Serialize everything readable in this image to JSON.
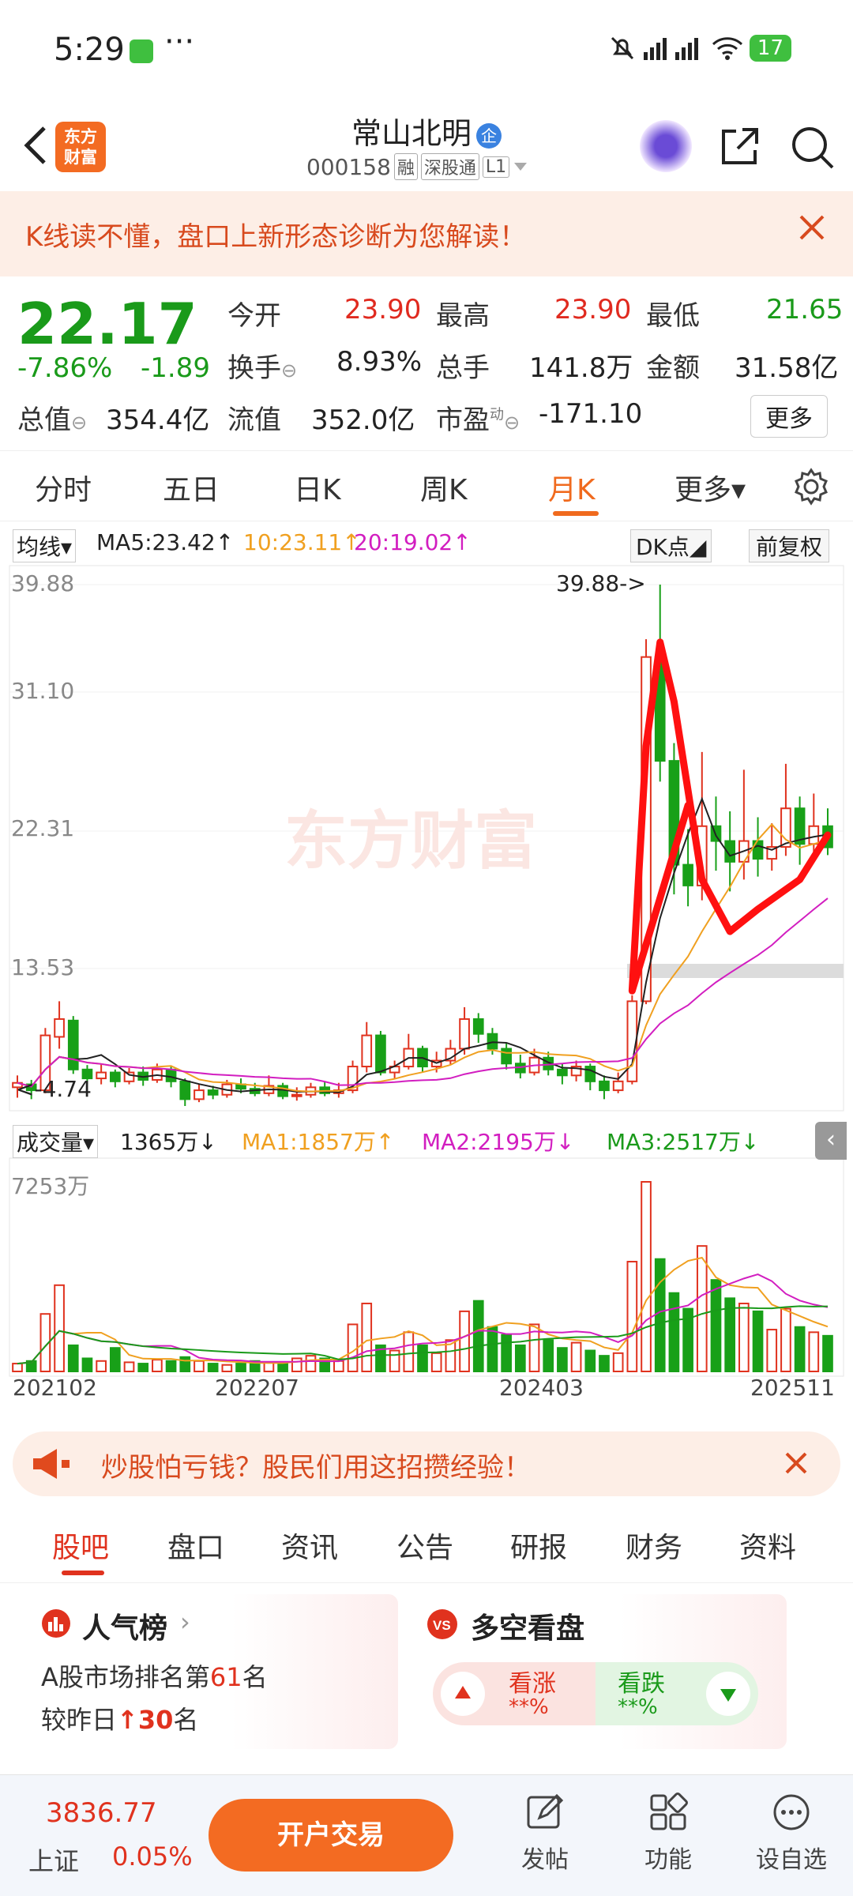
{
  "status": {
    "time": "5:29",
    "dots": "···",
    "battery": "17"
  },
  "header": {
    "title": "常山北明",
    "qi_badge": "企",
    "code": "000158",
    "tags": [
      "融",
      "深股通",
      "L1"
    ],
    "logo": "东方\n财富"
  },
  "banner": {
    "text": "K线读不懂，盘口上新形态诊断为您解读！"
  },
  "quote": {
    "price": "22.17",
    "change_pct": "-7.86%",
    "change": "-1.89",
    "open_label": "今开",
    "open": "23.90",
    "high_label": "最高",
    "high": "23.90",
    "low_label": "最低",
    "low": "21.65",
    "turnover_label": "换手",
    "turnover": "8.93%",
    "volume_label": "总手",
    "volume": "141.8万",
    "amount_label": "金额",
    "amount": "31.58亿",
    "mktcap_label": "总值",
    "mktcap": "354.4亿",
    "float_label": "流值",
    "float": "352.0亿",
    "pe_label": "市盈",
    "pe_sup": "动",
    "pe": "-171.10",
    "more": "更多"
  },
  "tabs": [
    "分时",
    "五日",
    "日K",
    "周K",
    "月K",
    "更多▾"
  ],
  "active_tab": "月K",
  "chart": {
    "ma_selector": "均线▾",
    "ma5": "MA5:23.42↑",
    "ma10": "10:23.11↑",
    "ma20": "20:19.02↑",
    "dk": "DK点◢",
    "adj": "前复权",
    "y_ticks": [
      "39.88",
      "31.10",
      "22.31",
      "13.53"
    ],
    "max_label": "39.88->",
    "min_label": "<-4.74",
    "watermark": "东方财富",
    "vol_selector": "成交量▾",
    "vol": "1365万↓",
    "vma1": "MA1:1857万↑",
    "vma2": "MA2:2195万↓",
    "vma3": "MA3:2517万↓",
    "vol_max": "7253万",
    "x_labels": [
      "202102",
      "202207",
      "202403",
      "202511"
    ]
  },
  "chart_data": {
    "type": "candlestick",
    "y_range": [
      4.74,
      39.88
    ],
    "candles": [
      {
        "o": 6.0,
        "c": 6.3,
        "h": 6.8,
        "l": 5.3
      },
      {
        "o": 6.2,
        "c": 5.8,
        "h": 6.5,
        "l": 5.2
      },
      {
        "o": 5.8,
        "c": 9.5,
        "h": 10.0,
        "l": 5.6
      },
      {
        "o": 9.4,
        "c": 10.6,
        "h": 11.8,
        "l": 8.6
      },
      {
        "o": 10.5,
        "c": 7.2,
        "h": 10.8,
        "l": 6.9
      },
      {
        "o": 7.2,
        "c": 6.6,
        "h": 7.5,
        "l": 6.2
      },
      {
        "o": 6.6,
        "c": 7.0,
        "h": 7.6,
        "l": 6.2
      },
      {
        "o": 7.0,
        "c": 6.4,
        "h": 7.2,
        "l": 6.0
      },
      {
        "o": 6.4,
        "c": 7.0,
        "h": 7.3,
        "l": 6.2
      },
      {
        "o": 7.0,
        "c": 6.5,
        "h": 7.4,
        "l": 6.1
      },
      {
        "o": 6.5,
        "c": 7.2,
        "h": 7.6,
        "l": 6.3
      },
      {
        "o": 7.2,
        "c": 6.4,
        "h": 7.4,
        "l": 6.0
      },
      {
        "o": 6.4,
        "c": 5.2,
        "h": 6.6,
        "l": 4.74
      },
      {
        "o": 5.2,
        "c": 5.8,
        "h": 6.2,
        "l": 5.0
      },
      {
        "o": 5.8,
        "c": 5.5,
        "h": 6.1,
        "l": 5.2
      },
      {
        "o": 5.5,
        "c": 6.2,
        "h": 6.5,
        "l": 5.3
      },
      {
        "o": 6.2,
        "c": 5.9,
        "h": 6.6,
        "l": 5.6
      },
      {
        "o": 5.9,
        "c": 5.6,
        "h": 6.3,
        "l": 5.4
      },
      {
        "o": 5.6,
        "c": 6.1,
        "h": 6.8,
        "l": 5.4
      },
      {
        "o": 6.1,
        "c": 5.4,
        "h": 6.3,
        "l": 5.2
      },
      {
        "o": 5.4,
        "c": 5.5,
        "h": 6.0,
        "l": 5.1
      },
      {
        "o": 5.5,
        "c": 6.0,
        "h": 6.3,
        "l": 5.3
      },
      {
        "o": 6.0,
        "c": 5.6,
        "h": 6.4,
        "l": 5.4
      },
      {
        "o": 5.6,
        "c": 5.8,
        "h": 6.3,
        "l": 5.3
      },
      {
        "o": 5.8,
        "c": 7.4,
        "h": 7.8,
        "l": 5.6
      },
      {
        "o": 7.4,
        "c": 9.5,
        "h": 10.4,
        "l": 7.0
      },
      {
        "o": 9.5,
        "c": 7.0,
        "h": 9.8,
        "l": 6.8
      },
      {
        "o": 7.0,
        "c": 7.4,
        "h": 7.8,
        "l": 6.6
      },
      {
        "o": 7.4,
        "c": 8.6,
        "h": 9.6,
        "l": 7.2
      },
      {
        "o": 8.6,
        "c": 7.4,
        "h": 8.8,
        "l": 7.0
      },
      {
        "o": 7.4,
        "c": 7.8,
        "h": 8.4,
        "l": 7.0
      },
      {
        "o": 7.8,
        "c": 8.6,
        "h": 9.2,
        "l": 7.5
      },
      {
        "o": 8.6,
        "c": 10.6,
        "h": 11.4,
        "l": 8.2
      },
      {
        "o": 10.6,
        "c": 9.6,
        "h": 11.0,
        "l": 9.0
      },
      {
        "o": 9.6,
        "c": 8.6,
        "h": 10.0,
        "l": 8.2
      },
      {
        "o": 8.6,
        "c": 7.6,
        "h": 9.0,
        "l": 7.2
      },
      {
        "o": 7.6,
        "c": 7.0,
        "h": 8.2,
        "l": 6.6
      },
      {
        "o": 7.0,
        "c": 8.0,
        "h": 8.6,
        "l": 6.8
      },
      {
        "o": 8.0,
        "c": 7.2,
        "h": 8.4,
        "l": 6.8
      },
      {
        "o": 7.2,
        "c": 6.8,
        "h": 7.6,
        "l": 6.2
      },
      {
        "o": 6.8,
        "c": 7.4,
        "h": 7.8,
        "l": 6.4
      },
      {
        "o": 7.4,
        "c": 6.4,
        "h": 7.6,
        "l": 5.8
      },
      {
        "o": 6.4,
        "c": 5.8,
        "h": 6.8,
        "l": 5.2
      },
      {
        "o": 5.8,
        "c": 6.4,
        "h": 7.0,
        "l": 5.6
      },
      {
        "o": 6.4,
        "c": 11.8,
        "h": 12.2,
        "l": 6.2
      },
      {
        "o": 11.8,
        "c": 35.0,
        "h": 36.2,
        "l": 11.6
      },
      {
        "o": 35.0,
        "c": 28.0,
        "h": 39.88,
        "l": 26.6
      },
      {
        "o": 28.0,
        "c": 21.0,
        "h": 29.2,
        "l": 19.0
      },
      {
        "o": 21.0,
        "c": 19.6,
        "h": 23.4,
        "l": 18.2
      },
      {
        "o": 19.6,
        "c": 23.6,
        "h": 28.6,
        "l": 18.6
      },
      {
        "o": 23.6,
        "c": 22.6,
        "h": 25.6,
        "l": 20.6
      },
      {
        "o": 22.6,
        "c": 21.2,
        "h": 24.6,
        "l": 19.2
      },
      {
        "o": 21.2,
        "c": 22.6,
        "h": 27.4,
        "l": 20.0
      },
      {
        "o": 22.6,
        "c": 21.4,
        "h": 24.2,
        "l": 20.2
      },
      {
        "o": 21.4,
        "c": 22.2,
        "h": 23.8,
        "l": 20.6
      },
      {
        "o": 22.2,
        "c": 24.8,
        "h": 27.8,
        "l": 21.6
      },
      {
        "o": 24.8,
        "c": 22.4,
        "h": 25.6,
        "l": 21.0
      },
      {
        "o": 22.4,
        "c": 23.6,
        "h": 25.8,
        "l": 21.6
      },
      {
        "o": 23.6,
        "c": 22.17,
        "h": 24.8,
        "l": 21.65
      }
    ],
    "volume_max": 7253,
    "volumes": [
      300,
      400,
      2200,
      3300,
      1000,
      500,
      400,
      900,
      350,
      300,
      450,
      400,
      550,
      400,
      300,
      250,
      300,
      400,
      350,
      300,
      500,
      600,
      500,
      400,
      1800,
      2600,
      1000,
      800,
      1500,
      1000,
      700,
      1200,
      2300,
      2700,
      1700,
      1400,
      1000,
      1800,
      1200,
      900,
      1100,
      800,
      600,
      700,
      4200,
      7253,
      4300,
      3000,
      2400,
      4800,
      3500,
      2800,
      2600,
      2300,
      1600,
      2400,
      1700,
      1500,
      1365
    ]
  },
  "promo": {
    "text": "炒股怕亏钱？股民们用这招攒经验！"
  },
  "subtabs": [
    "股吧",
    "盘口",
    "资讯",
    "公告",
    "研报",
    "财务",
    "资料"
  ],
  "cards": {
    "hot_title": "人气榜",
    "hot_line1a": "A股市场排名第",
    "hot_rank": "61",
    "hot_line1b": "名",
    "hot_line2a": "较昨日",
    "hot_up": "↑30",
    "hot_line2b": "名",
    "vs_title": "多空看盘",
    "bull": "看涨",
    "bull_pct": "**%",
    "bear": "看跌",
    "bear_pct": "**%"
  },
  "bottom": {
    "index_value": "3836.77",
    "index_name": "上证",
    "index_pct": "0.05%",
    "trade": "开户交易",
    "post": "发帖",
    "func": "功能",
    "watch": "设自选"
  }
}
